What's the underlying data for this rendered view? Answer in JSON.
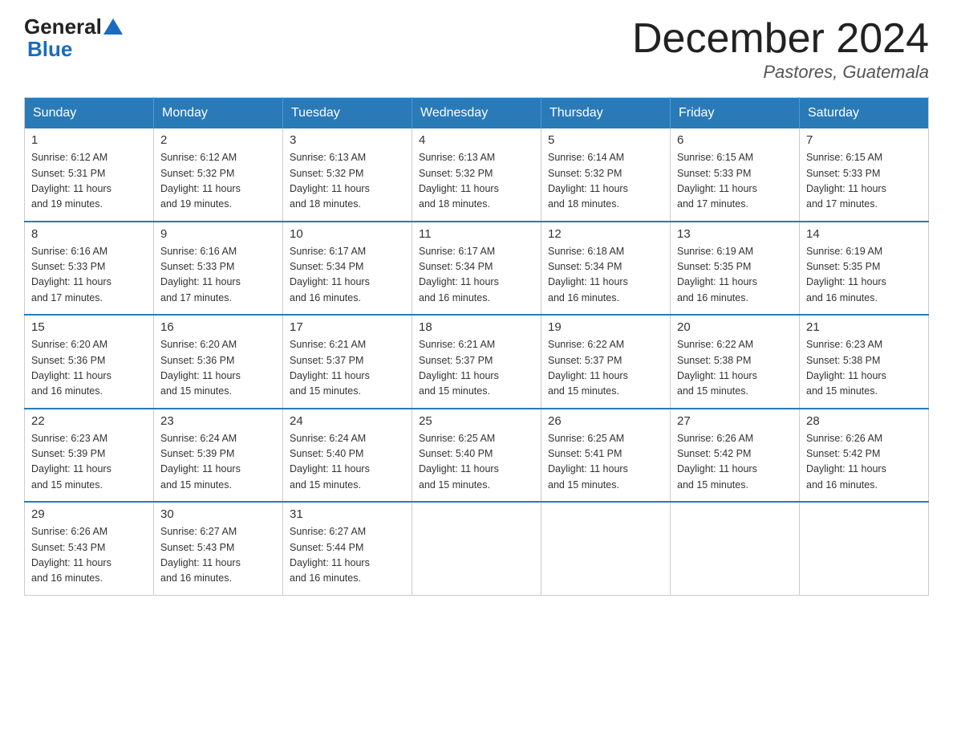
{
  "logo": {
    "part1": "General",
    "part2": "Blue"
  },
  "title": "December 2024",
  "location": "Pastores, Guatemala",
  "weekdays": [
    "Sunday",
    "Monday",
    "Tuesday",
    "Wednesday",
    "Thursday",
    "Friday",
    "Saturday"
  ],
  "weeks": [
    [
      {
        "day": "1",
        "sunrise": "6:12 AM",
        "sunset": "5:31 PM",
        "daylight": "11 hours and 19 minutes."
      },
      {
        "day": "2",
        "sunrise": "6:12 AM",
        "sunset": "5:32 PM",
        "daylight": "11 hours and 19 minutes."
      },
      {
        "day": "3",
        "sunrise": "6:13 AM",
        "sunset": "5:32 PM",
        "daylight": "11 hours and 18 minutes."
      },
      {
        "day": "4",
        "sunrise": "6:13 AM",
        "sunset": "5:32 PM",
        "daylight": "11 hours and 18 minutes."
      },
      {
        "day": "5",
        "sunrise": "6:14 AM",
        "sunset": "5:32 PM",
        "daylight": "11 hours and 18 minutes."
      },
      {
        "day": "6",
        "sunrise": "6:15 AM",
        "sunset": "5:33 PM",
        "daylight": "11 hours and 17 minutes."
      },
      {
        "day": "7",
        "sunrise": "6:15 AM",
        "sunset": "5:33 PM",
        "daylight": "11 hours and 17 minutes."
      }
    ],
    [
      {
        "day": "8",
        "sunrise": "6:16 AM",
        "sunset": "5:33 PM",
        "daylight": "11 hours and 17 minutes."
      },
      {
        "day": "9",
        "sunrise": "6:16 AM",
        "sunset": "5:33 PM",
        "daylight": "11 hours and 17 minutes."
      },
      {
        "day": "10",
        "sunrise": "6:17 AM",
        "sunset": "5:34 PM",
        "daylight": "11 hours and 16 minutes."
      },
      {
        "day": "11",
        "sunrise": "6:17 AM",
        "sunset": "5:34 PM",
        "daylight": "11 hours and 16 minutes."
      },
      {
        "day": "12",
        "sunrise": "6:18 AM",
        "sunset": "5:34 PM",
        "daylight": "11 hours and 16 minutes."
      },
      {
        "day": "13",
        "sunrise": "6:19 AM",
        "sunset": "5:35 PM",
        "daylight": "11 hours and 16 minutes."
      },
      {
        "day": "14",
        "sunrise": "6:19 AM",
        "sunset": "5:35 PM",
        "daylight": "11 hours and 16 minutes."
      }
    ],
    [
      {
        "day": "15",
        "sunrise": "6:20 AM",
        "sunset": "5:36 PM",
        "daylight": "11 hours and 16 minutes."
      },
      {
        "day": "16",
        "sunrise": "6:20 AM",
        "sunset": "5:36 PM",
        "daylight": "11 hours and 15 minutes."
      },
      {
        "day": "17",
        "sunrise": "6:21 AM",
        "sunset": "5:37 PM",
        "daylight": "11 hours and 15 minutes."
      },
      {
        "day": "18",
        "sunrise": "6:21 AM",
        "sunset": "5:37 PM",
        "daylight": "11 hours and 15 minutes."
      },
      {
        "day": "19",
        "sunrise": "6:22 AM",
        "sunset": "5:37 PM",
        "daylight": "11 hours and 15 minutes."
      },
      {
        "day": "20",
        "sunrise": "6:22 AM",
        "sunset": "5:38 PM",
        "daylight": "11 hours and 15 minutes."
      },
      {
        "day": "21",
        "sunrise": "6:23 AM",
        "sunset": "5:38 PM",
        "daylight": "11 hours and 15 minutes."
      }
    ],
    [
      {
        "day": "22",
        "sunrise": "6:23 AM",
        "sunset": "5:39 PM",
        "daylight": "11 hours and 15 minutes."
      },
      {
        "day": "23",
        "sunrise": "6:24 AM",
        "sunset": "5:39 PM",
        "daylight": "11 hours and 15 minutes."
      },
      {
        "day": "24",
        "sunrise": "6:24 AM",
        "sunset": "5:40 PM",
        "daylight": "11 hours and 15 minutes."
      },
      {
        "day": "25",
        "sunrise": "6:25 AM",
        "sunset": "5:40 PM",
        "daylight": "11 hours and 15 minutes."
      },
      {
        "day": "26",
        "sunrise": "6:25 AM",
        "sunset": "5:41 PM",
        "daylight": "11 hours and 15 minutes."
      },
      {
        "day": "27",
        "sunrise": "6:26 AM",
        "sunset": "5:42 PM",
        "daylight": "11 hours and 15 minutes."
      },
      {
        "day": "28",
        "sunrise": "6:26 AM",
        "sunset": "5:42 PM",
        "daylight": "11 hours and 16 minutes."
      }
    ],
    [
      {
        "day": "29",
        "sunrise": "6:26 AM",
        "sunset": "5:43 PM",
        "daylight": "11 hours and 16 minutes."
      },
      {
        "day": "30",
        "sunrise": "6:27 AM",
        "sunset": "5:43 PM",
        "daylight": "11 hours and 16 minutes."
      },
      {
        "day": "31",
        "sunrise": "6:27 AM",
        "sunset": "5:44 PM",
        "daylight": "11 hours and 16 minutes."
      },
      null,
      null,
      null,
      null
    ]
  ]
}
